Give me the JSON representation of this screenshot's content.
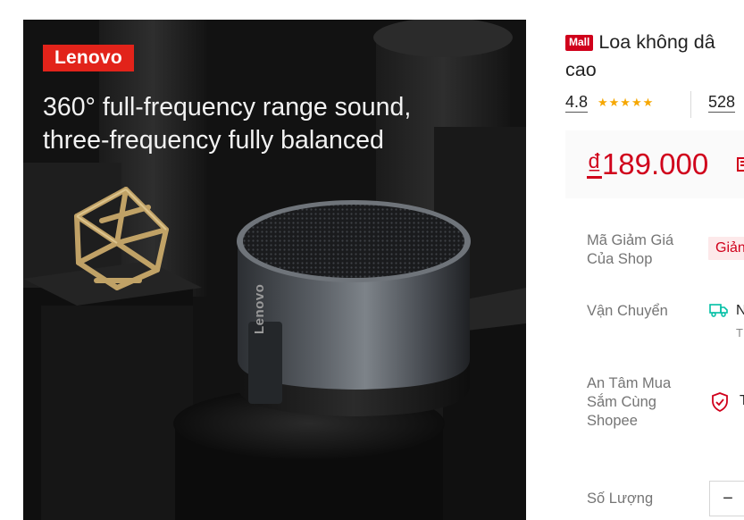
{
  "product_image": {
    "brand_tag": "Lenovo",
    "headline_line1": "360° full-frequency range sound,",
    "headline_line2": "three-frequency fully balanced",
    "speaker_logo": "Lenovo"
  },
  "product": {
    "mall_badge": "Mall",
    "title_line1": "Loa không dâ",
    "title_line2": "cao",
    "rating": "4.8",
    "rating_stars": 5,
    "stars_display": "★★★★★",
    "review_count": "528",
    "price": "₫189.000",
    "price_currency": "₫",
    "price_amount": "189.000"
  },
  "details": {
    "voucher_label": "Mã Giảm Giá Của Shop",
    "voucher_chip": "Giản",
    "shipping_label": "Vận Chuyển",
    "shipping_text": "N",
    "shipping_sub": "T",
    "guarantee_label": "An Tâm Mua Sắm Cùng Shopee",
    "guarantee_text": "T",
    "quantity_label": "Số Lượng",
    "quantity_minus": "−"
  },
  "colors": {
    "brand_red": "#e2231a",
    "price_red": "#d0011b",
    "star_color": "#f6a700",
    "shipping_green": "#00bfa5"
  },
  "icons": [
    "mall-badge",
    "star-icon",
    "discount-icon",
    "truck-icon",
    "shield-check-icon"
  ]
}
